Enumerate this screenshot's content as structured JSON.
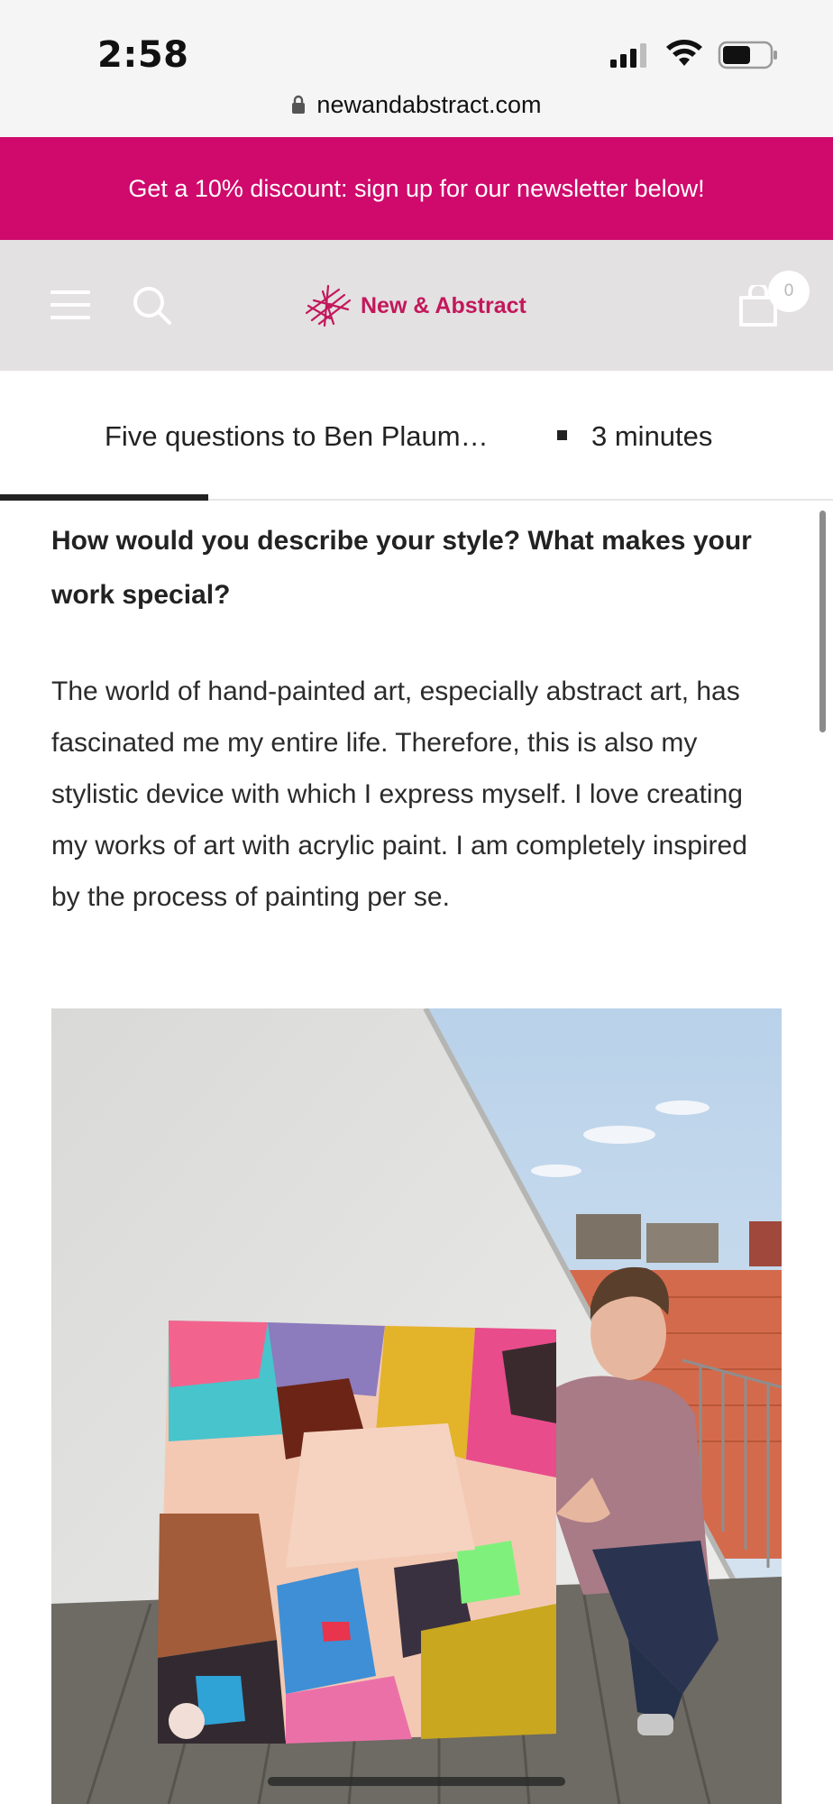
{
  "status_bar": {
    "time": "2:58",
    "url": "newandabstract.com"
  },
  "promo_banner": {
    "text": "Get a 10% discount: sign up for our newsletter below!",
    "background": "#cf0a6c"
  },
  "header": {
    "logo_text": "New & Abstract",
    "cart_count": "0",
    "icons": [
      "menu-icon",
      "search-icon",
      "cart-icon"
    ]
  },
  "article_bar": {
    "title": "Five questions to Ben Plaum…",
    "read_time": "3 minutes",
    "progress_fraction": 0.25
  },
  "content": {
    "question": "How would you describe your style? What makes your work special?",
    "answer": "The world of hand-painted art, especially abstract art, has fascinated me my entire life. Therefore, this is also my stylistic device with which I express myself. I love creating my works of art with acrylic paint. I am completely inspired by the process of painting per se."
  },
  "colors": {
    "accent": "#cf0a6c",
    "header_bg": "#e3e1e2"
  }
}
